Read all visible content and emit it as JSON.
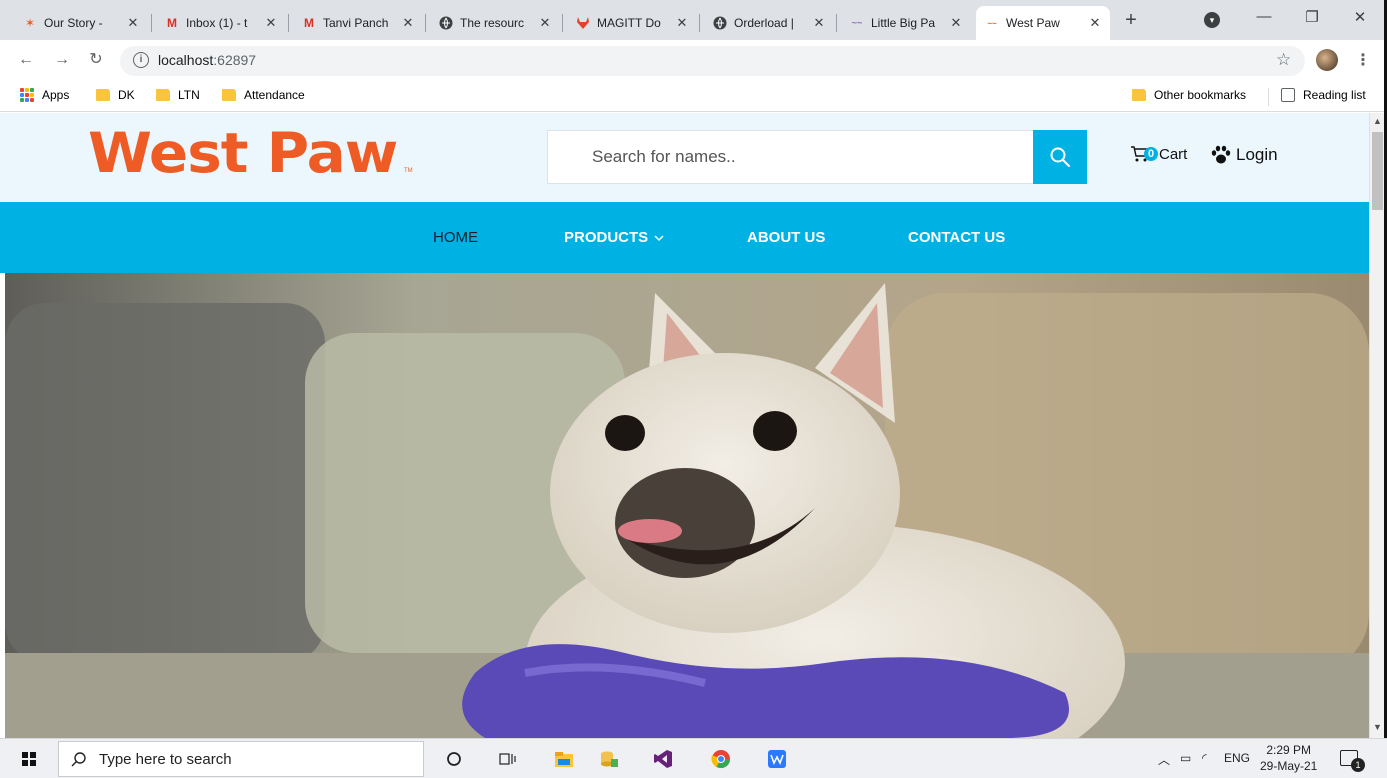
{
  "browser": {
    "tabs": [
      {
        "label": "Our Story - ",
        "favicon": "west-paw-logo-icon"
      },
      {
        "label": "Inbox (1) - t",
        "favicon": "gmail-icon"
      },
      {
        "label": "Tanvi Panch",
        "favicon": "gmail-icon"
      },
      {
        "label": "The resourc",
        "favicon": "globe-icon"
      },
      {
        "label": "MAGITT Do",
        "favicon": "gitlab-icon"
      },
      {
        "label": "Orderload |",
        "favicon": "globe-icon"
      },
      {
        "label": "Little Big Pa",
        "favicon": "little-big-paw-icon"
      },
      {
        "label": "West Paw",
        "favicon": "west-paw-logo-icon",
        "active": true
      }
    ],
    "address": {
      "host": "localhost",
      "port": ":62897"
    },
    "bookmarks": [
      {
        "label": "Apps"
      },
      {
        "label": "DK"
      },
      {
        "label": "LTN"
      },
      {
        "label": "Attendance"
      }
    ],
    "other_bookmarks": "Other bookmarks",
    "reading_list": "Reading list"
  },
  "site": {
    "logo_text": "West Paw",
    "logo_tm": "TM",
    "search_placeholder": "Search for names..",
    "cart_count": "0",
    "cart_label": "Cart",
    "login_label": "Login",
    "nav": {
      "home": "HOME",
      "products": "PRODUCTS",
      "about": "ABOUT US",
      "contact": "CONTACT US"
    },
    "colors": {
      "brand_orange": "#ef5b25",
      "accent_blue": "#00b1e3",
      "header_bg": "#ebf7fc"
    }
  },
  "taskbar": {
    "search_placeholder": "Type here to search",
    "language": "ENG",
    "time": "2:29 PM",
    "date": "29-May-21",
    "notification_count": "1"
  }
}
